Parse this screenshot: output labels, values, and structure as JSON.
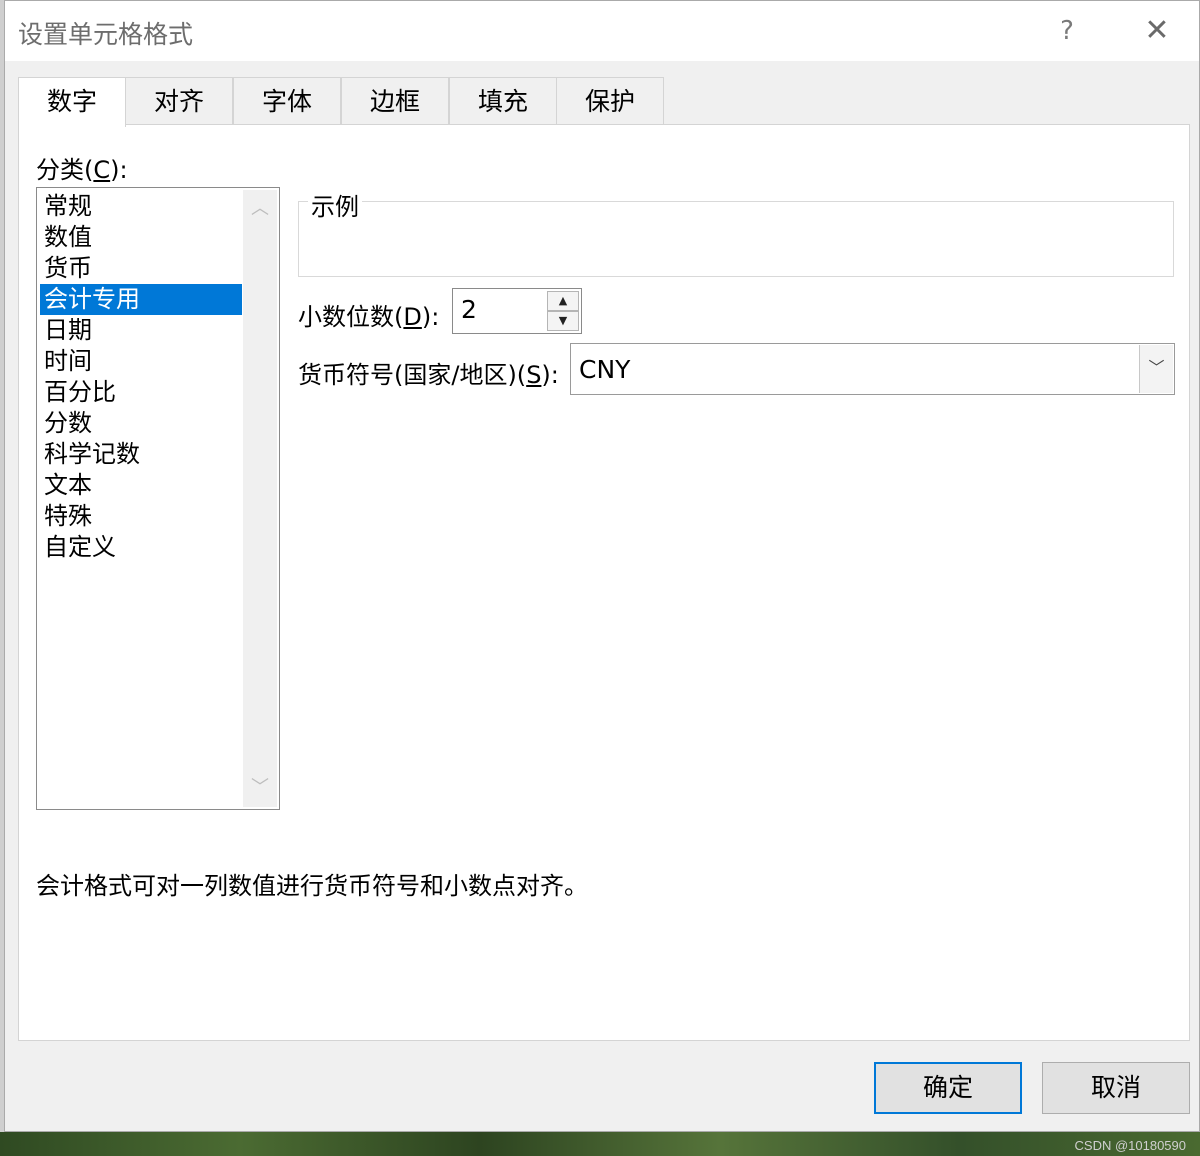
{
  "dialog": {
    "title": "设置单元格格式",
    "help_glyph": "?",
    "close_glyph": "✕"
  },
  "tabs": [
    {
      "label": "数字",
      "active": true
    },
    {
      "label": "对齐"
    },
    {
      "label": "字体"
    },
    {
      "label": "边框"
    },
    {
      "label": "填充"
    },
    {
      "label": "保护"
    }
  ],
  "category": {
    "label_prefix": "分类(",
    "label_key": "C",
    "label_suffix": "):",
    "items": [
      "常规",
      "数值",
      "货币",
      "会计专用",
      "日期",
      "时间",
      "百分比",
      "分数",
      "科学记数",
      "文本",
      "特殊",
      "自定义"
    ],
    "selected": "会计专用"
  },
  "sample": {
    "label": "示例"
  },
  "decimal": {
    "label_prefix": "小数位数(",
    "label_key": "D",
    "label_suffix": "):",
    "value": "2"
  },
  "currency": {
    "label_prefix": "货币符号(国家/地区)(",
    "label_key": "S",
    "label_suffix": "):",
    "value": "CNY"
  },
  "description": "会计格式可对一列数值进行货币符号和小数点对齐。",
  "buttons": {
    "ok": "确定",
    "cancel": "取消"
  },
  "watermark": "CSDN @10180590"
}
